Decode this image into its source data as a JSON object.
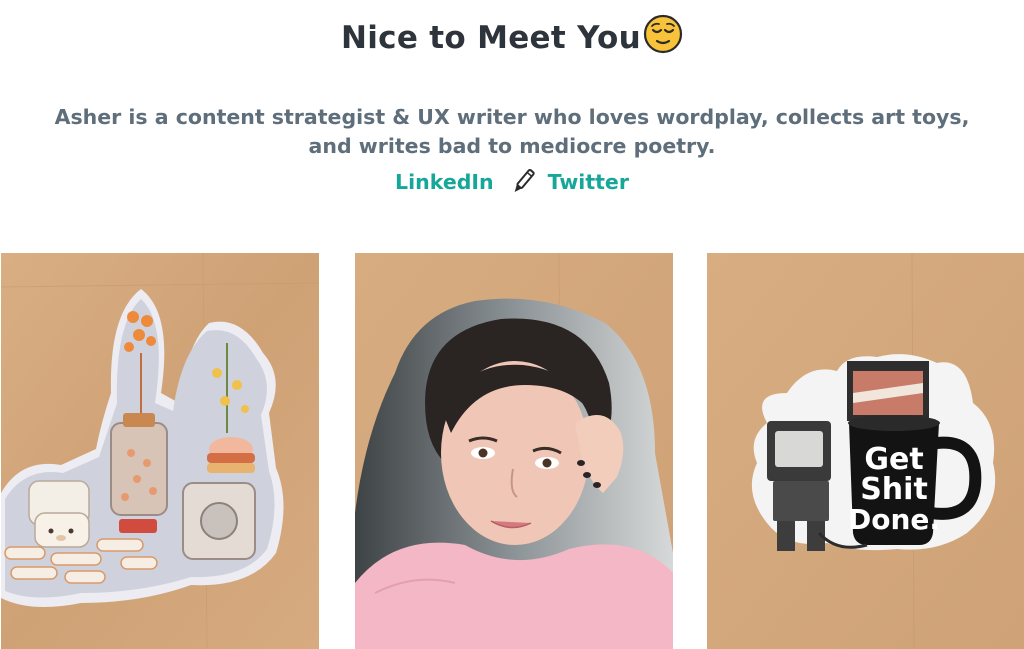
{
  "header": {
    "title": "Nice to Meet You"
  },
  "bio": {
    "line1": "Asher is a content strategist & UX writer who loves wordplay, collects art toys,",
    "line2": "and writes bad to mediocre poetry."
  },
  "social": {
    "linkedin": "LinkedIn",
    "twitter": "Twitter"
  },
  "mug": {
    "line1": "Get",
    "line2": "Shit",
    "line3": "Done."
  },
  "colors": {
    "heading": "#2e343b",
    "body": "#5f6e7b",
    "link": "#16a79a",
    "kraft": "#d3a77a"
  }
}
